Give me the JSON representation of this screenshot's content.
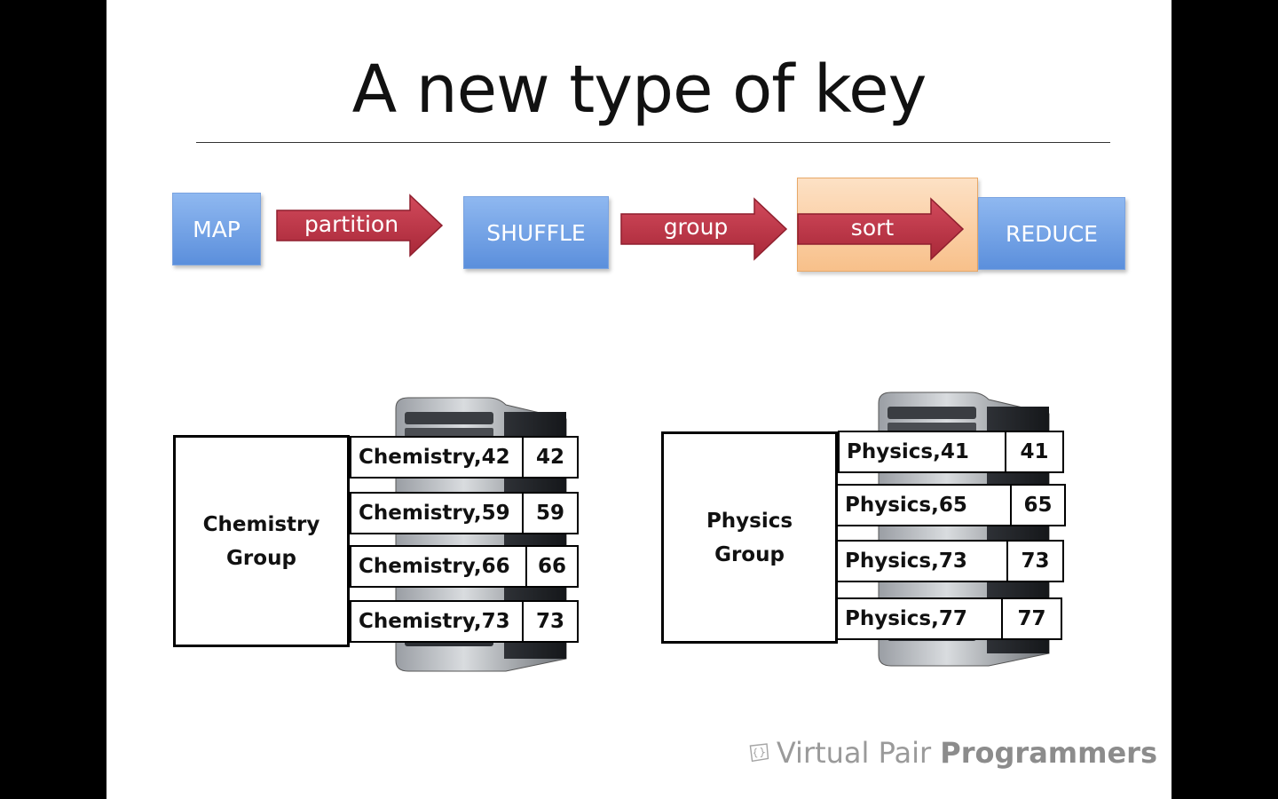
{
  "slide": {
    "title": "A new type of key"
  },
  "pipeline": {
    "stages": {
      "map": "MAP",
      "shuffle": "SHUFFLE",
      "reduce": "REDUCE"
    },
    "steps": {
      "partition": "partition",
      "group": "group",
      "sort": "sort"
    }
  },
  "chemistry": {
    "group_line1": "Chemistry",
    "group_line2": "Group",
    "records": [
      {
        "key": "Chemistry,42",
        "value": "42"
      },
      {
        "key": "Chemistry,59",
        "value": "59"
      },
      {
        "key": "Chemistry,66",
        "value": "66"
      },
      {
        "key": "Chemistry,73",
        "value": "73"
      }
    ]
  },
  "physics": {
    "group_line1": "Physics",
    "group_line2": "Group",
    "records": [
      {
        "key": "Physics,41",
        "value": "41"
      },
      {
        "key": "Physics,65",
        "value": "65"
      },
      {
        "key": "Physics,73",
        "value": "73"
      },
      {
        "key": "Physics,77",
        "value": "77"
      }
    ]
  },
  "logo": {
    "brand_light": "Virtual Pair",
    "brand_bold": "Programmers",
    "icon": "brackets-logo-icon"
  },
  "colors": {
    "stage_blue": "#6b9be0",
    "arrow_red": "#c0394a",
    "sort_orange": "#f8c08a"
  }
}
